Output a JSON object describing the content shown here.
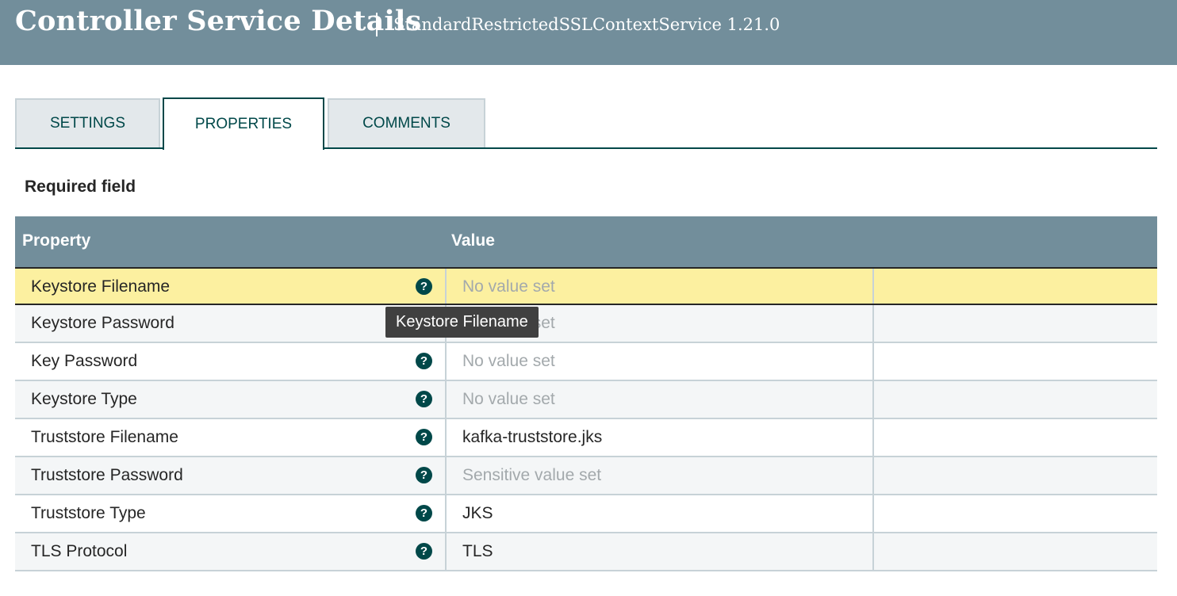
{
  "header": {
    "title": "Controller Service Details",
    "subtitle": "StandardRestrictedSSLContextService 1.21.0"
  },
  "tabs": [
    {
      "label": "SETTINGS",
      "active": false
    },
    {
      "label": "PROPERTIES",
      "active": true
    },
    {
      "label": "COMMENTS",
      "active": false
    }
  ],
  "required_field_label": "Required field",
  "table": {
    "headers": {
      "property": "Property",
      "value": "Value"
    },
    "rows": [
      {
        "name": "Keystore Filename",
        "value": "No value set",
        "muted": true,
        "selected": true
      },
      {
        "name": "Keystore Password",
        "value": "No value set",
        "muted": true,
        "selected": false
      },
      {
        "name": "Key Password",
        "value": "No value set",
        "muted": true,
        "selected": false
      },
      {
        "name": "Keystore Type",
        "value": "No value set",
        "muted": true,
        "selected": false
      },
      {
        "name": "Truststore Filename",
        "value": "kafka-truststore.jks",
        "muted": false,
        "selected": false
      },
      {
        "name": "Truststore Password",
        "value": "Sensitive value set",
        "muted": true,
        "selected": false
      },
      {
        "name": "Truststore Type",
        "value": "JKS",
        "muted": false,
        "selected": false
      },
      {
        "name": "TLS Protocol",
        "value": "TLS",
        "muted": false,
        "selected": false
      }
    ]
  },
  "tooltip": {
    "text": "Keystore Filename"
  },
  "icons": {
    "help": "question-circle-icon"
  },
  "colors": {
    "header_bg": "#728e9b",
    "accent": "#004849",
    "selected_row_bg": "#fcf0a0",
    "muted_text": "#a3a9ac"
  }
}
